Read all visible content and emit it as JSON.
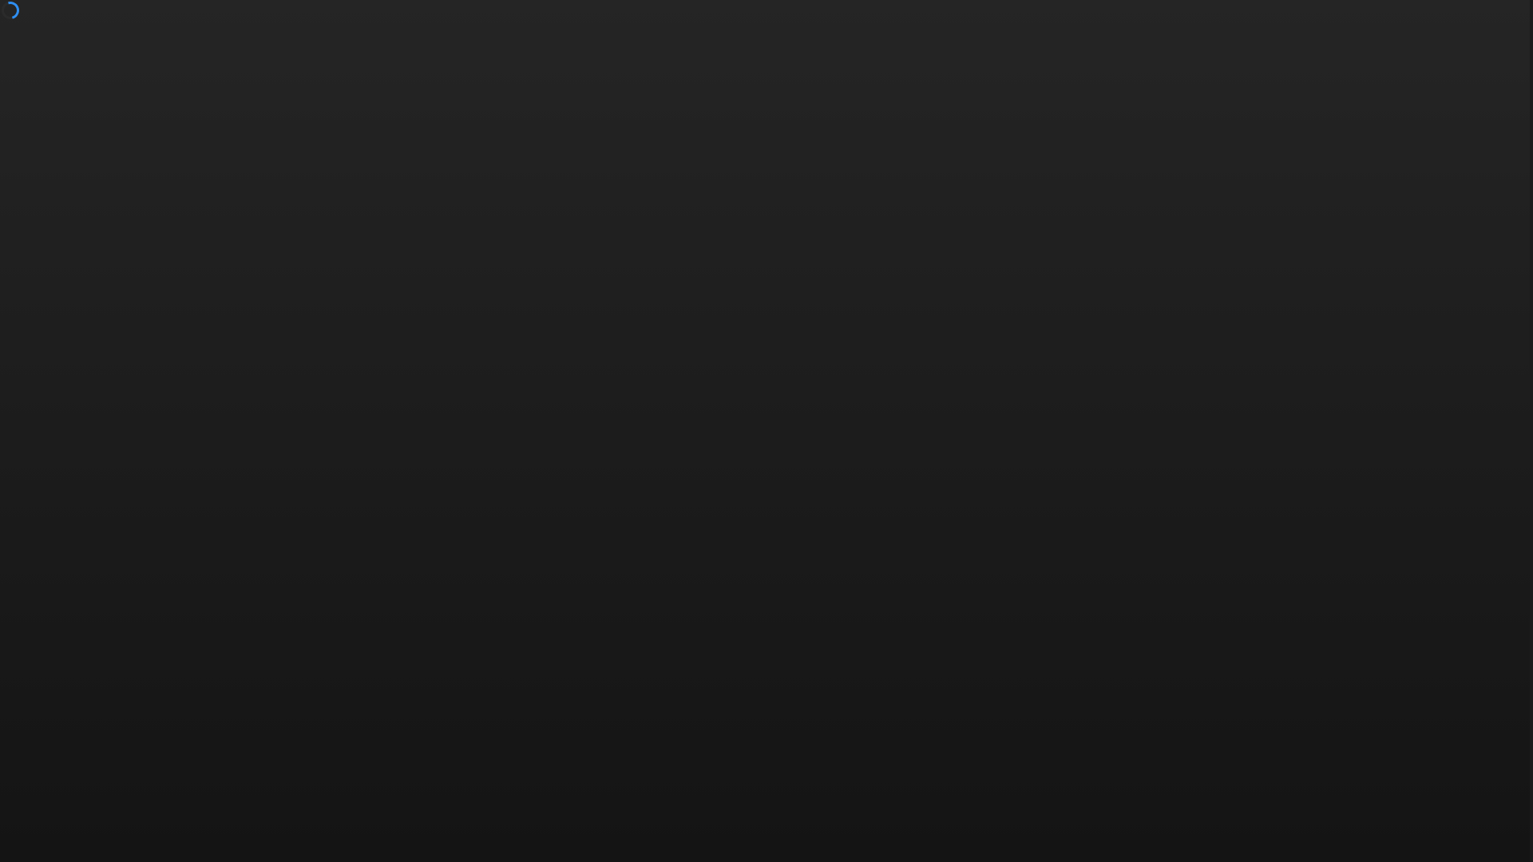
{
  "page": {
    "state": "loading"
  },
  "spinner": {
    "icon": "loading-spinner-icon",
    "color": "#2f8ff2"
  },
  "background": {
    "top_color": "#252525",
    "bottom_color": "#141414"
  }
}
